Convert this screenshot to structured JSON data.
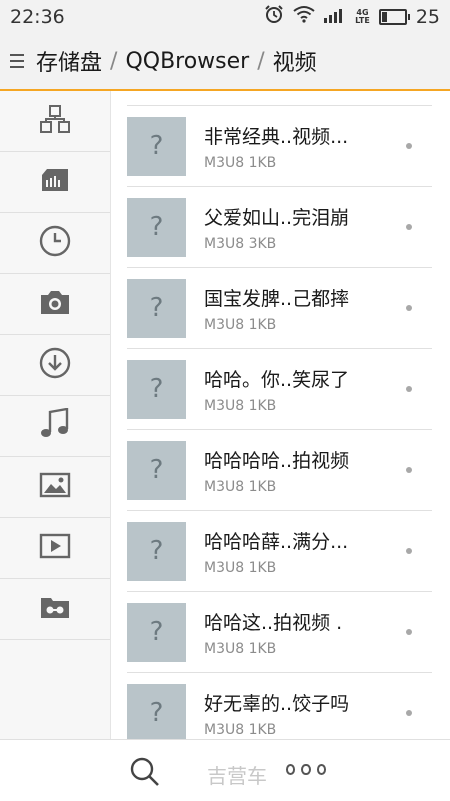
{
  "status": {
    "time": "22:36",
    "network": "4G",
    "network_sub": "LTE",
    "battery": "25",
    "battery_level": 0.25
  },
  "header": {
    "path": [
      "存储盘",
      "QQBrowser",
      "视频"
    ],
    "separator": "/"
  },
  "sidebar": {
    "items": [
      {
        "icon": "category-icon"
      },
      {
        "icon": "sd-card-icon"
      },
      {
        "icon": "clock-icon"
      },
      {
        "icon": "camera-icon"
      },
      {
        "icon": "download-icon"
      },
      {
        "icon": "music-icon"
      },
      {
        "icon": "image-icon"
      },
      {
        "icon": "video-icon"
      },
      {
        "icon": "vr-folder-icon"
      }
    ]
  },
  "files": [
    {
      "name": "非常经典..视频...",
      "meta": "M3U8 1KB"
    },
    {
      "name": "父爱如山..完泪崩",
      "meta": "M3U8 3KB"
    },
    {
      "name": "国宝发脾..己都摔",
      "meta": "M3U8 1KB"
    },
    {
      "name": "哈哈。你..笑尿了",
      "meta": "M3U8 1KB"
    },
    {
      "name": "哈哈哈哈..拍视频",
      "meta": "M3U8 1KB"
    },
    {
      "name": "哈哈哈薛..满分...",
      "meta": "M3U8 1KB"
    },
    {
      "name": "哈哈这..拍视频 .",
      "meta": "M3U8 1KB"
    },
    {
      "name": "好无辜的..饺子吗",
      "meta": "M3U8 1KB"
    }
  ],
  "thumb_glyph": "?",
  "bottom": {
    "ghost_text": "吉营车"
  },
  "colors": {
    "accent": "#f5a623",
    "thumb": "#b9c4c9"
  }
}
